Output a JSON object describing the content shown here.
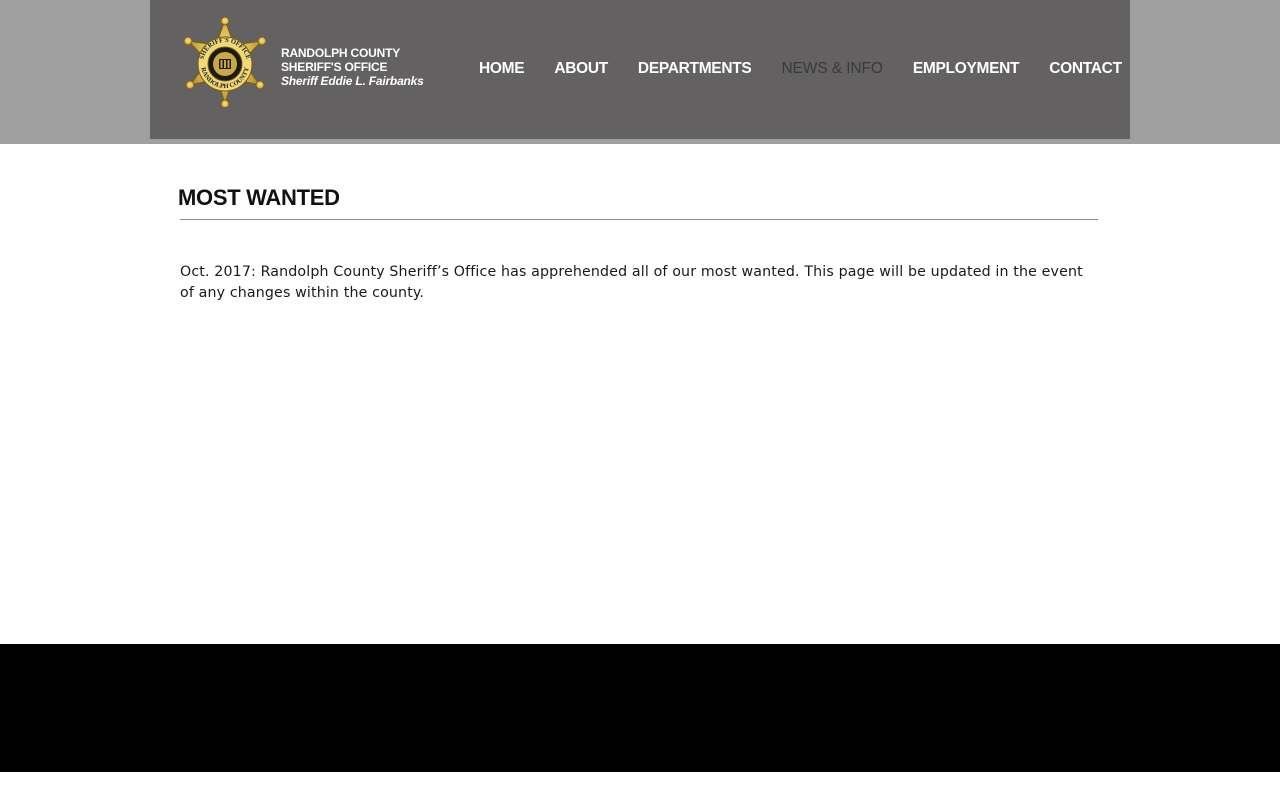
{
  "brand": {
    "line1": "RANDOLPH COUNTY",
    "line2": "SHERIFF'S OFFICE",
    "line3": "Sheriff Eddie L. Fairbanks",
    "badge_icon": "sheriff-star-badge-icon",
    "badge_top_text": "SHERIFF'S OFFICE",
    "badge_bottom_text": "RANDOLPH COUNTY"
  },
  "nav": {
    "items": [
      {
        "label": "HOME",
        "active": false
      },
      {
        "label": "ABOUT",
        "active": false
      },
      {
        "label": "DEPARTMENTS",
        "active": false
      },
      {
        "label": "NEWS & INFO",
        "active": true
      },
      {
        "label": "EMPLOYMENT",
        "active": false
      },
      {
        "label": "CONTACT",
        "active": false
      }
    ]
  },
  "main": {
    "title": "MOST WANTED",
    "body": "Oct. 2017: Randolph County Sheriff’s Office has apprehended all of our most wanted. This page will be updated in the event of any changes within the county."
  },
  "colors": {
    "header_band": "#a0a0a0",
    "header_inner": "#636162",
    "nav_active": "#3a3a3a",
    "footer": "#000000",
    "badge_gold": "#d9b74a"
  }
}
